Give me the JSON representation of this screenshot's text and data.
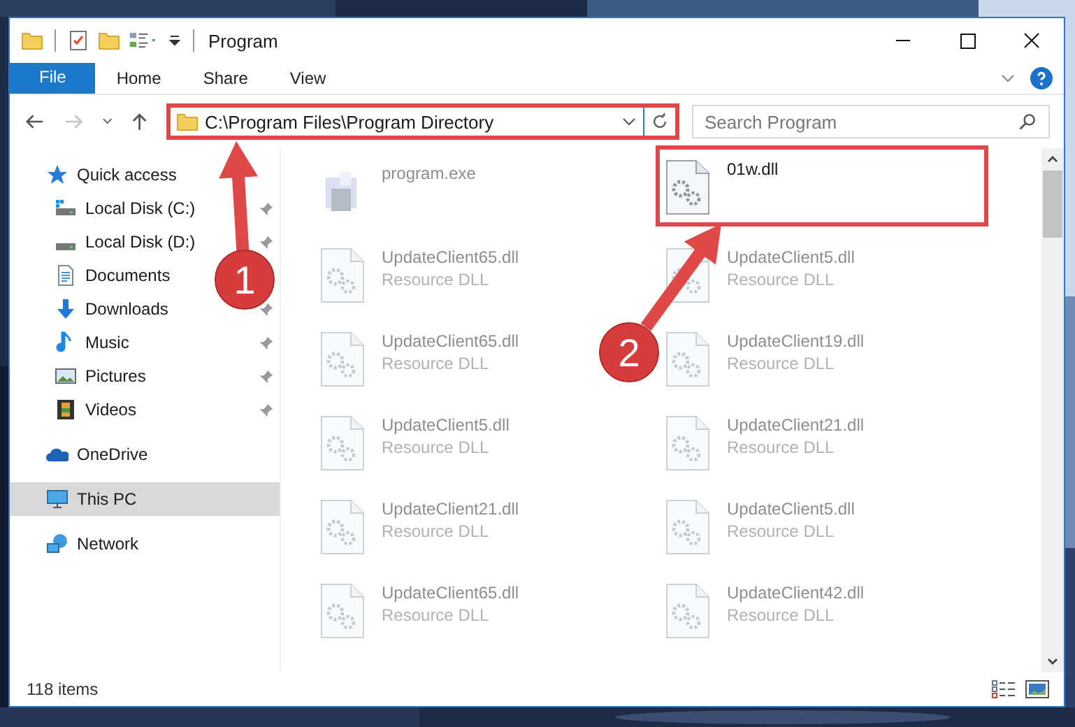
{
  "window": {
    "title": "Program"
  },
  "ribbon_tabs": [
    {
      "label": "File",
      "kind": "menu"
    },
    {
      "label": "Home",
      "kind": "tab"
    },
    {
      "label": "Share",
      "kind": "tab"
    },
    {
      "label": "View",
      "kind": "tab"
    }
  ],
  "address": {
    "path": "C:\\Program Files\\Program Directory",
    "highlighted": true
  },
  "search": {
    "placeholder": "Search Program"
  },
  "sidebar": {
    "items": [
      {
        "label": "Quick access",
        "kind": "star",
        "selected": false,
        "children": [
          {
            "label": "Local Disk (C:)",
            "kind": "systemdrive",
            "pinned": true,
            "selected": false
          },
          {
            "label": "Local Disk (D:)",
            "kind": "drive",
            "pinned": true,
            "selected": false
          },
          {
            "label": "Documents",
            "kind": "documents",
            "selected": false
          },
          {
            "label": "Downloads",
            "kind": "downloads",
            "pinned": true,
            "selected": false
          },
          {
            "label": "Music",
            "kind": "music",
            "pinned": true,
            "selected": false
          },
          {
            "label": "Pictures",
            "kind": "pictures",
            "pinned": true,
            "selected": false
          },
          {
            "label": "Videos",
            "kind": "videos",
            "pinned": true,
            "selected": false
          }
        ]
      },
      {
        "label": "OneDrive",
        "kind": "cloud",
        "selected": false
      },
      {
        "label": "This PC",
        "kind": "pc",
        "selected": true
      },
      {
        "label": "Network",
        "kind": "network",
        "selected": false
      }
    ]
  },
  "files": [
    {
      "name": "program.exe",
      "kind": "exe",
      "dimmed": true,
      "highlighted": false
    },
    {
      "name": "01w.dll",
      "kind": "dll",
      "dimmed": false,
      "highlighted": true
    },
    {
      "name": "UpdateClient65.dll",
      "type": "Resource DLL",
      "kind": "dll",
      "dimmed": true,
      "highlighted": false
    },
    {
      "name": "UpdateClient5.dll",
      "type": "Resource DLL",
      "kind": "dll",
      "dimmed": true,
      "highlighted": false
    },
    {
      "name": "UpdateClient65.dll",
      "type": "Resource DLL",
      "kind": "dll",
      "dimmed": true,
      "highlighted": false
    },
    {
      "name": "UpdateClient19.dll",
      "type": "Resource DLL",
      "kind": "dll",
      "dimmed": true,
      "highlighted": false
    },
    {
      "name": "UpdateClient5.dll",
      "type": "Resource DLL",
      "kind": "dll",
      "dimmed": true,
      "highlighted": false
    },
    {
      "name": "UpdateClient21.dll",
      "type": "Resource DLL",
      "kind": "dll",
      "dimmed": true,
      "highlighted": false
    },
    {
      "name": "UpdateClient21.dll",
      "type": "Resource DLL",
      "kind": "dll",
      "dimmed": true,
      "highlighted": false
    },
    {
      "name": "UpdateClient5.dll",
      "type": "Resource DLL",
      "kind": "dll",
      "dimmed": true,
      "highlighted": false
    },
    {
      "name": "UpdateClient65.dll",
      "type": "Resource DLL",
      "kind": "dll",
      "dimmed": true,
      "highlighted": false
    },
    {
      "name": "UpdateClient42.dll",
      "type": "Resource DLL",
      "kind": "dll",
      "dimmed": true,
      "highlighted": false
    }
  ],
  "status_bar": {
    "text": "118 items"
  },
  "annotations": [
    {
      "label": "1"
    },
    {
      "label": "2"
    }
  ]
}
